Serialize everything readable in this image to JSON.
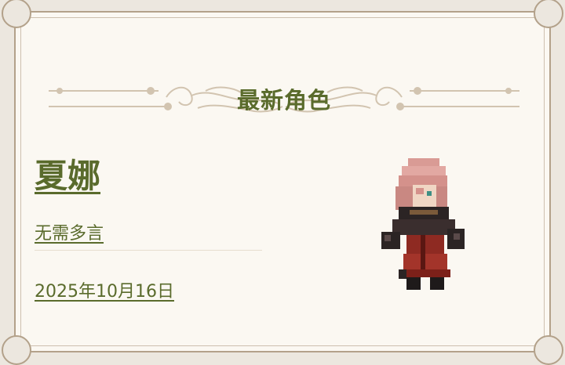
{
  "section": {
    "title": "最新角色"
  },
  "character": {
    "name": "夏娜",
    "subtitle": "无需多言",
    "date": "2025年10月16日",
    "sprite_icon": "pixel-character-sprite"
  },
  "colors": {
    "accent": "#5a6b2c",
    "frame": "#b3a18a",
    "card_bg": "#fbf8f2",
    "page_bg": "#ece7df",
    "ornament": "#d2c4b0"
  }
}
